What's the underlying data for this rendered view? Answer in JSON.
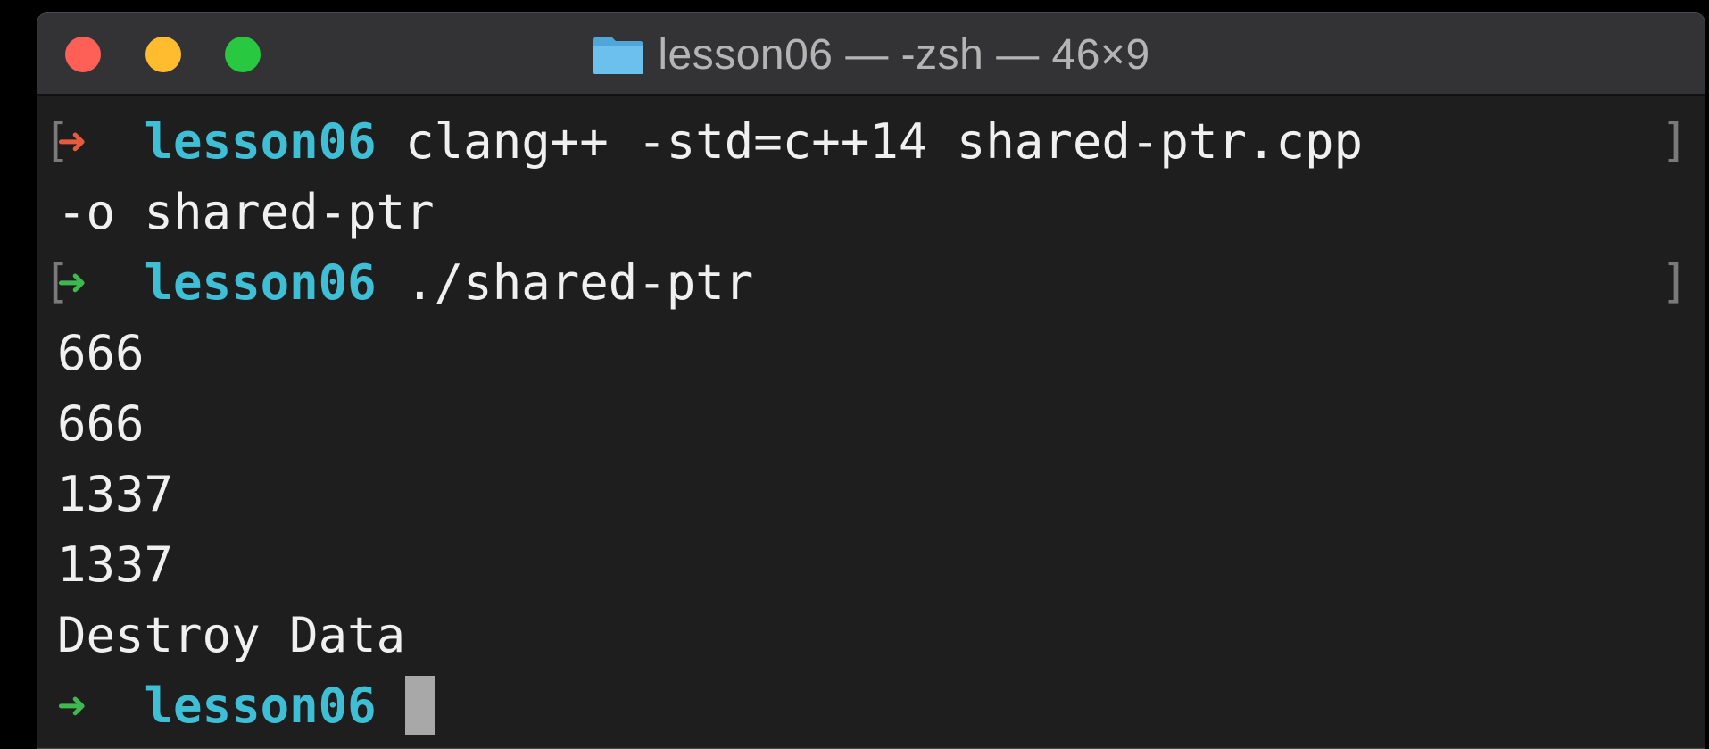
{
  "window": {
    "title": "lesson06 — -zsh — 46×9"
  },
  "colors": {
    "close": "#fe5f57",
    "minimize": "#febc2e",
    "zoom": "#28c840",
    "prompt_arrow_error": "#e55b3e",
    "prompt_arrow_ok": "#3fb850",
    "directory": "#3fbfd6",
    "text": "#f0f0f0",
    "background": "#1e1e1e"
  },
  "icons": {
    "title": "folder-icon",
    "prompt": "arrow-right-icon"
  },
  "terminal": {
    "prompt_symbol": "➜",
    "lines": [
      {
        "type": "prompt",
        "status": "error",
        "dir": "lesson06",
        "command": "clang++ -std=c++14 shared-ptr.cpp",
        "marked": true
      },
      {
        "type": "output",
        "text": "-o shared-ptr"
      },
      {
        "type": "prompt",
        "status": "ok",
        "dir": "lesson06",
        "command": "./shared-ptr",
        "marked": true
      },
      {
        "type": "output",
        "text": "666"
      },
      {
        "type": "output",
        "text": "666"
      },
      {
        "type": "output",
        "text": "1337"
      },
      {
        "type": "output",
        "text": "1337"
      },
      {
        "type": "output",
        "text": "Destroy Data"
      },
      {
        "type": "prompt",
        "status": "ok",
        "dir": "lesson06",
        "command": "",
        "marked": false,
        "cursor": true
      }
    ]
  }
}
